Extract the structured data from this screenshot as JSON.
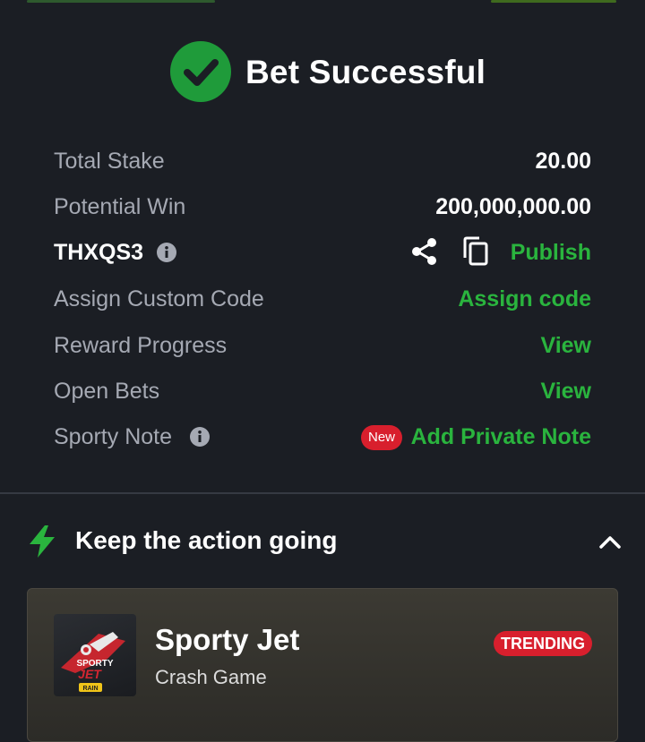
{
  "header": {
    "title": "Bet Successful",
    "icon": "check-circle-icon",
    "accent": "#1f9b3a"
  },
  "summary": {
    "total_stake_label": "Total Stake",
    "total_stake_value": "20.00",
    "potential_win_label": "Potential Win",
    "potential_win_value": "200,000,000.00",
    "booking_code": "THXQS3",
    "publish_label": "Publish",
    "assign_label": "Assign Custom Code",
    "assign_action": "Assign code",
    "reward_label": "Reward Progress",
    "reward_action": "View",
    "open_bets_label": "Open Bets",
    "open_bets_action": "View",
    "note_label": "Sporty Note",
    "note_badge": "New",
    "note_action": "Add Private Note"
  },
  "section": {
    "title": "Keep the action going"
  },
  "game_card": {
    "name": "Sporty Jet",
    "type": "Crash Game",
    "badge": "TRENDING",
    "thumb_text_1": "SPORTY",
    "thumb_text_2": "JET",
    "thumb_text_3": "RAIN"
  },
  "colors": {
    "green": "#2ab43e",
    "red": "#d81f2d",
    "background": "#1b1e24",
    "muted": "#a5a9b3"
  }
}
